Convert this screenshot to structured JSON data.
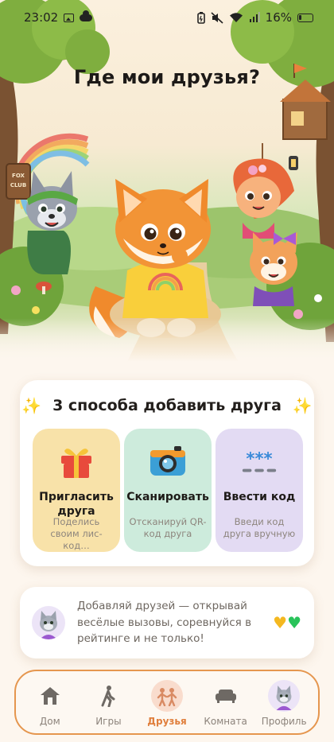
{
  "status_bar": {
    "time": "23:02",
    "battery": "16%",
    "left_icons": [
      "image-icon",
      "cloud-icon"
    ],
    "right_icons": [
      "battery-saver-icon",
      "mute-icon",
      "wifi-icon",
      "signal-icon"
    ]
  },
  "hero": {
    "title": "Где мои друзья?",
    "sign_text": "FOX CLUB"
  },
  "ways": {
    "title": "3 способа добавить друга",
    "tiles": [
      {
        "id": "invite",
        "label": "Пригласить друга",
        "subtitle": "Поделись своим лис-код…",
        "icon": "gift-icon",
        "color": "#f8e2a9"
      },
      {
        "id": "scan",
        "label": "Сканировать",
        "subtitle": "Отсканируй QR-код друга",
        "icon": "camera-icon",
        "color": "#cdebdc"
      },
      {
        "id": "code",
        "label": "Ввести код",
        "subtitle": "Введи код друга вручную",
        "icon": "code-icon",
        "color": "#e3dbf3"
      }
    ]
  },
  "info": {
    "text": "Добавляй друзей — открывай весёлые вызовы, соревнуйся в рейтинге и не только!"
  },
  "nav": {
    "items": [
      {
        "id": "home",
        "label": "Дом",
        "icon": "home-icon",
        "active": false
      },
      {
        "id": "games",
        "label": "Игры",
        "icon": "games-icon",
        "active": false
      },
      {
        "id": "friends",
        "label": "Друзья",
        "icon": "friends-icon",
        "active": true
      },
      {
        "id": "room",
        "label": "Комната",
        "icon": "sofa-icon",
        "active": false
      },
      {
        "id": "profile",
        "label": "Профиль",
        "icon": "avatar-icon",
        "active": false
      }
    ]
  },
  "colors": {
    "accent": "#e07f3d",
    "nav_border": "#e5964e",
    "background": "#fdf6ee"
  }
}
